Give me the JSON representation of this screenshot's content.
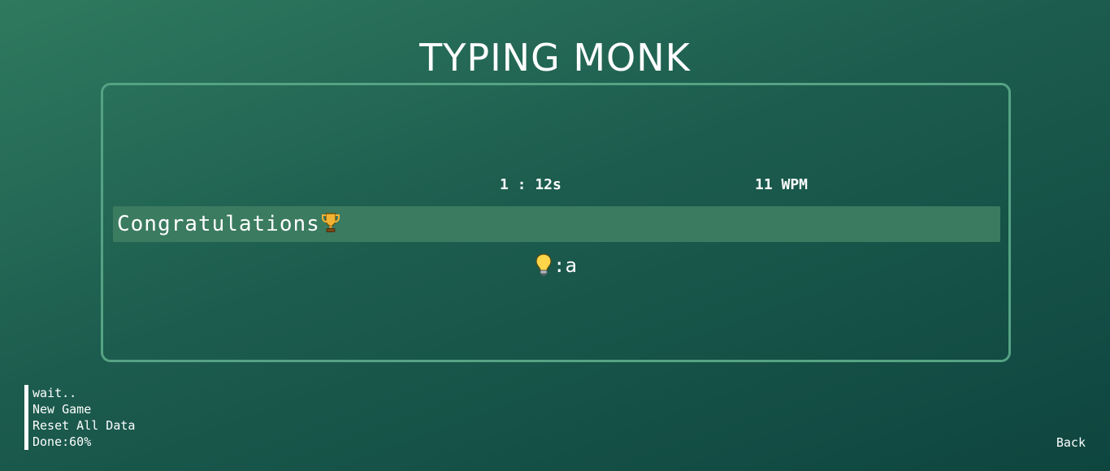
{
  "app": {
    "title": "TYPING MONK"
  },
  "stats": {
    "time": "1 : 12s",
    "wpm": "11 WPM"
  },
  "typing": {
    "current_line": "Congratulations",
    "line_icon": "trophy-icon"
  },
  "hint": {
    "icon": "lightbulb-icon",
    "text": ":a"
  },
  "menu": {
    "items": [
      {
        "label": "wait.."
      },
      {
        "label": "New Game"
      },
      {
        "label": "Reset All Data"
      },
      {
        "label": "Done:60%"
      }
    ]
  },
  "footer": {
    "back_label": "Back"
  },
  "colors": {
    "panel_border": "#55a384",
    "line_highlight": "#3b7b60",
    "background_start": "#2f7a5f",
    "background_end": "#0e453f"
  }
}
